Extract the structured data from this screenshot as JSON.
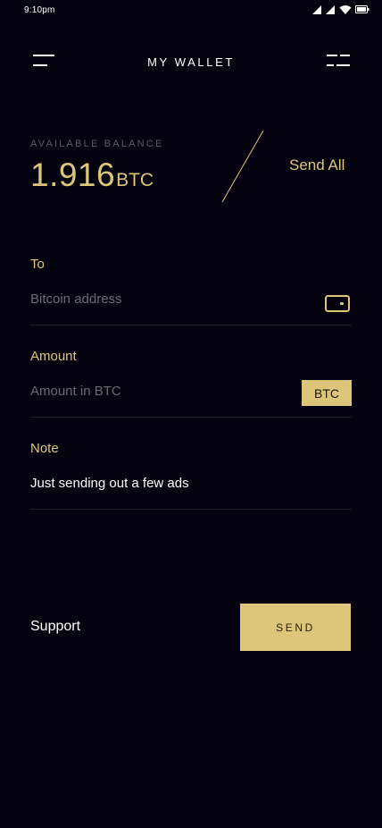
{
  "status_bar": {
    "time": "9:10pm",
    "icons": [
      "signal-icon",
      "signal-icon",
      "wifi-icon",
      "battery-icon"
    ]
  },
  "header": {
    "title": "MY WALLET",
    "left_icon": "menu-icon",
    "right_icon": "filter-icon"
  },
  "balance": {
    "label": "AVAILABLE BALANCE",
    "amount": "1.916",
    "unit": "BTC",
    "send_all_label": "Send All"
  },
  "form": {
    "to": {
      "label": "To",
      "placeholder": "Bitcoin address",
      "icon": "wallet-icon"
    },
    "amount": {
      "label": "Amount",
      "placeholder": "Amount in BTC",
      "currency": "BTC"
    },
    "note": {
      "label": "Note",
      "value": "Just sending out a few ads"
    }
  },
  "footer": {
    "support_label": "Support",
    "send_label": "SEND"
  },
  "colors": {
    "background": "#04030f",
    "accent": "#ddc57a",
    "muted": "#6a6a75",
    "text": "#ffffff"
  }
}
